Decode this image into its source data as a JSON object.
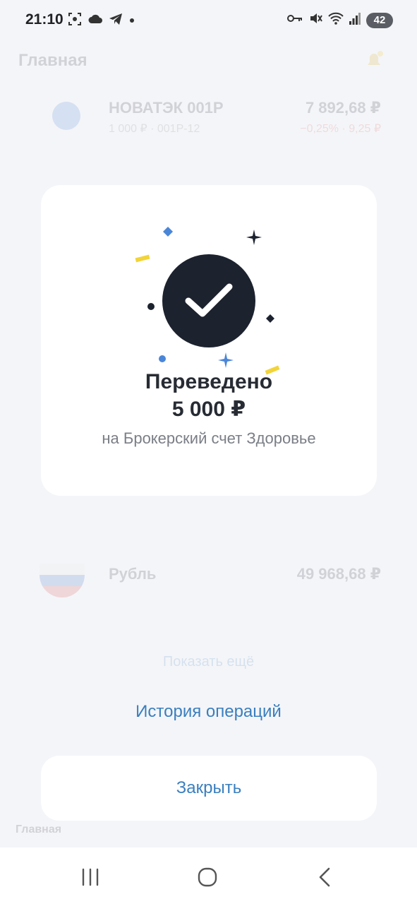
{
  "status_bar": {
    "time": "21:10",
    "battery_level": "42",
    "icons": [
      "screenshot-icon",
      "cloud-icon",
      "telegram-icon",
      "dot-icon",
      "vpn-key-icon",
      "mute-icon",
      "wifi-icon",
      "signal-icon"
    ]
  },
  "background": {
    "title": "Главная",
    "rows": [
      {
        "name": "НОВАТЭК 001Р",
        "sub": "1 000 ₽ · 001Р-12",
        "value": "7 892,68 ₽",
        "change": "−0,25% · 9,25 ₽"
      },
      {
        "name": "Рубль",
        "value": "49 968,68 ₽"
      }
    ],
    "show_more": "Показать ещё",
    "tab_home": "Главная"
  },
  "dialog": {
    "title": "Переведено",
    "amount": "5 000 ₽",
    "subtitle": "на Брокерский счет Здоровье"
  },
  "actions": {
    "history_label": "История операций",
    "close_label": "Закрыть"
  },
  "nav": {
    "icons": [
      "recents-icon",
      "home-icon",
      "back-icon"
    ]
  },
  "colors": {
    "accent": "#3a7fbf",
    "check_bg": "#1c222e",
    "confetti_blue": "#4a86d8",
    "confetti_yellow": "#f2d43a",
    "confetti_dark": "#1c222e"
  }
}
